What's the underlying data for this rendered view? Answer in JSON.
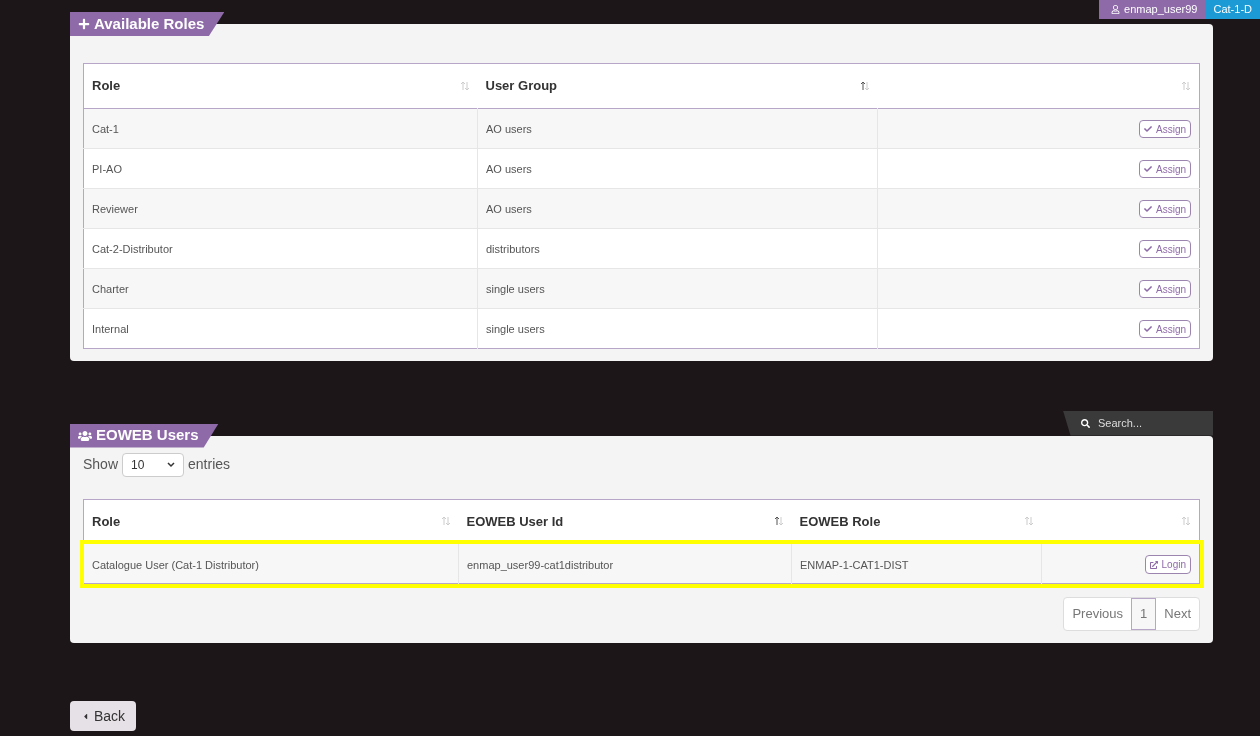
{
  "user_bar": {
    "username": "enmap_user99",
    "role": "Cat-1-D"
  },
  "roles_panel": {
    "title": "Available Roles",
    "columns": [
      {
        "label": "Role",
        "sorted": false
      },
      {
        "label": "User Group",
        "sorted": true
      },
      {
        "sorted": false
      }
    ],
    "rows": [
      {
        "role": "Cat-1",
        "group": "AO users",
        "action": "Assign"
      },
      {
        "role": "PI-AO",
        "group": "AO users",
        "action": "Assign"
      },
      {
        "role": "Reviewer",
        "group": "AO users",
        "action": "Assign"
      },
      {
        "role": "Cat-2-Distributor",
        "group": "distributors",
        "action": "Assign"
      },
      {
        "role": "Charter",
        "group": "single users",
        "action": "Assign"
      },
      {
        "role": "Internal",
        "group": "single users",
        "action": "Assign"
      }
    ]
  },
  "users_panel": {
    "title": "EOWEB Users",
    "search": {
      "placeholder": "Search..."
    },
    "length": {
      "before": "Show",
      "value": "10",
      "after": "entries"
    },
    "columns": [
      {
        "label": "Role",
        "sorted": false
      },
      {
        "label": "EOWEB User Id",
        "sorted": true
      },
      {
        "label": "EOWEB Role",
        "sorted": false
      },
      {
        "sorted": false
      }
    ],
    "rows": [
      {
        "role": "Catalogue User (Cat-1 Distributor)",
        "user_id": "enmap_user99-cat1distributor",
        "eoweb_role": "ENMAP-1-CAT1-DIST",
        "action": "Login",
        "highlighted": true
      }
    ],
    "pagination": [
      {
        "label": "Previous",
        "selected": false
      },
      {
        "label": "1",
        "selected": true
      },
      {
        "label": "Next",
        "selected": false
      }
    ]
  },
  "back_button": "Back"
}
